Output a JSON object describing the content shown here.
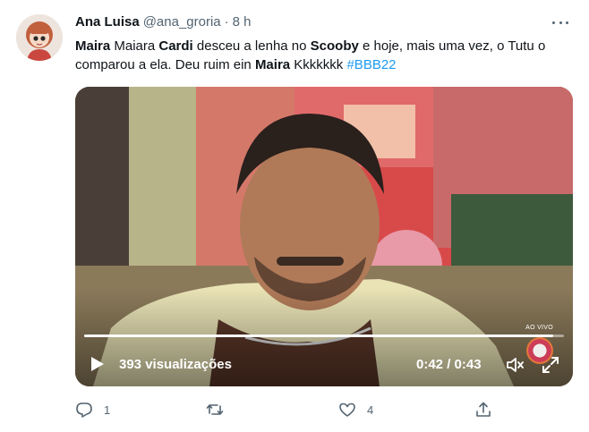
{
  "author": {
    "display_name": "Ana Luisa",
    "handle": "@ana_groria",
    "separator": "·",
    "time": "8 h"
  },
  "tweet": {
    "segments": [
      {
        "text": "Maira",
        "bold": true
      },
      {
        "text": " Maiara ",
        "bold": false
      },
      {
        "text": "Cardi",
        "bold": true
      },
      {
        "text": " desceu a lenha no ",
        "bold": false
      },
      {
        "text": "Scooby",
        "bold": true
      },
      {
        "text": " e hoje, mais uma vez, o Tutu o comparou a ela. Deu ruim ein ",
        "bold": false
      },
      {
        "text": "Maira",
        "bold": true
      },
      {
        "text": " Kkkkkkk ",
        "bold": false
      },
      {
        "text": "#BBB22",
        "hashtag": true
      }
    ]
  },
  "video": {
    "views": "393 visualizações",
    "timecode": "0:42 / 0:43",
    "progress": 0.977,
    "live_badge": "AO VIVO"
  },
  "actions": {
    "reply_count": "1",
    "retweet_count": "",
    "like_count": "4"
  },
  "colors": {
    "link": "#1d9bf0",
    "secondary_text": "#536471",
    "primary_text": "#0f1419"
  }
}
